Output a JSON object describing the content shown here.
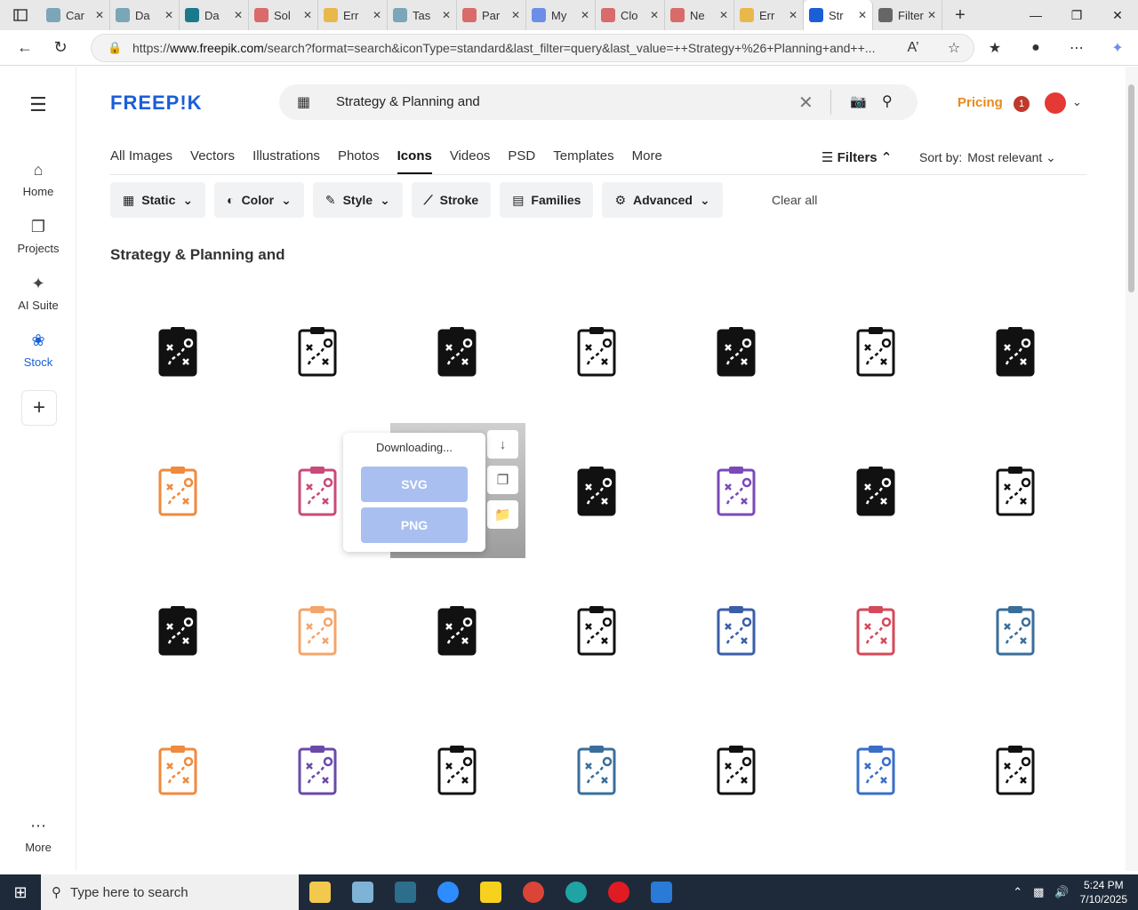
{
  "browser": {
    "tabs": [
      {
        "label": "Car",
        "color": "#7aa6b8"
      },
      {
        "label": "Da",
        "color": "#7aa6b8"
      },
      {
        "label": "Da",
        "color": "#1a7a8c"
      },
      {
        "label": "Sol",
        "color": "#d96b6b"
      },
      {
        "label": "Err",
        "color": "#e8b84a"
      },
      {
        "label": "Tas",
        "color": "#7aa6b8"
      },
      {
        "label": "Par",
        "color": "#d96b6b"
      },
      {
        "label": "My",
        "color": "#6b8ee8"
      },
      {
        "label": "Clo",
        "color": "#d96b6b"
      },
      {
        "label": "Ne",
        "color": "#d96b6b"
      },
      {
        "label": "Err",
        "color": "#e8b84a"
      },
      {
        "label": "Str",
        "color": "#1a5ed8"
      },
      {
        "label": "Filter &",
        "color": "#666666"
      }
    ],
    "active_tab_index": 11,
    "url_prefix": "https://",
    "url_host": "www.freepik.com",
    "url_rest": "/search?format=search&iconType=standard&last_filter=query&last_value=++Strategy+%26+Planning+and++..."
  },
  "site": {
    "logo": "FREEP!K",
    "search_query": "Strategy & Planning and",
    "pricing": "Pricing",
    "notif_count": "1",
    "leftnav": [
      {
        "label": "Home",
        "icon": "home-icon"
      },
      {
        "label": "Projects",
        "icon": "projects-icon"
      },
      {
        "label": "AI Suite",
        "icon": "ai-suite-icon"
      },
      {
        "label": "Stock",
        "icon": "stock-icon",
        "selected": true
      }
    ],
    "more_label": "More",
    "tabs": [
      "All Images",
      "Vectors",
      "Illustrations",
      "Photos",
      "Icons",
      "Videos",
      "PSD",
      "Templates",
      "More"
    ],
    "active_tab": "Icons",
    "filters_label": "Filters",
    "sort_label": "Sort by:",
    "sort_value": "Most relevant",
    "chips": [
      "Static",
      "Color",
      "Style",
      "Stroke",
      "Families",
      "Advanced"
    ],
    "clear_all": "Clear all",
    "heading": "Strategy & Planning and",
    "download_popup": {
      "status": "Downloading...",
      "svg": "SVG",
      "png": "PNG"
    }
  },
  "taskbar": {
    "search_placeholder": "Type here to search",
    "time": "5:24 PM",
    "date": "7/10/2025"
  }
}
